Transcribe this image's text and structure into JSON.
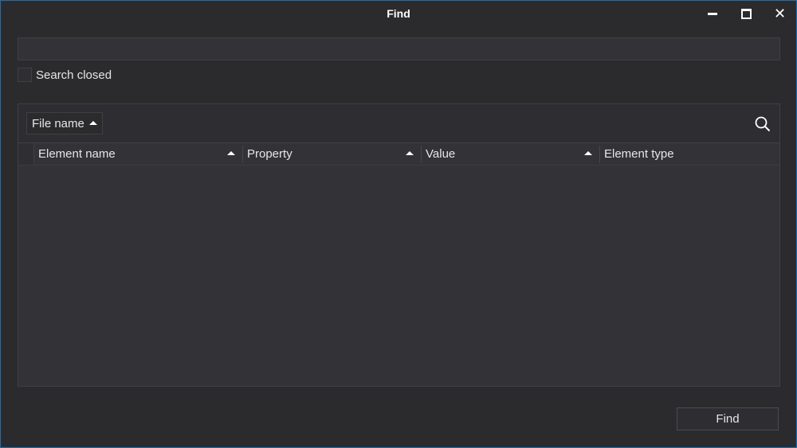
{
  "window": {
    "title": "Find",
    "minimize_icon": "minimize-icon",
    "maximize_icon": "maximize-icon",
    "close_icon": "close-icon",
    "close_glyph": "✕"
  },
  "search": {
    "value": "",
    "placeholder": ""
  },
  "options": {
    "search_closed_label": "Search closed",
    "search_closed_checked": false
  },
  "results": {
    "group_by": {
      "label": "File name",
      "sort": "ascending"
    },
    "search_icon": "search-icon",
    "columns": [
      {
        "label": "Element name",
        "sort": "ascending"
      },
      {
        "label": "Property",
        "sort": "ascending"
      },
      {
        "label": "Value",
        "sort": "ascending"
      },
      {
        "label": "Element type"
      }
    ],
    "rows": []
  },
  "actions": {
    "find_label": "Find"
  },
  "colors": {
    "accent_border": "#1f6fb2",
    "background": "#2b2b2e",
    "panel": "#333337",
    "text": "#e6e6e6"
  }
}
